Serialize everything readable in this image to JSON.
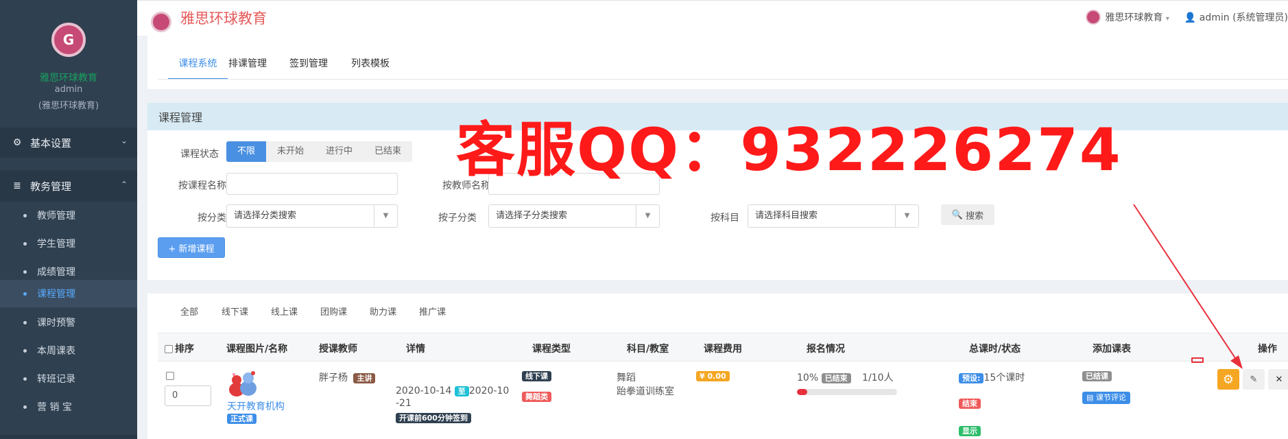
{
  "sidebar": {
    "brand": "雅思环球教育",
    "username": "admin",
    "role": "(雅思环球教育)",
    "sections": [
      {
        "label": "基本设置",
        "icon": "gear-icon",
        "expanded": false
      },
      {
        "label": "教务管理",
        "icon": "database-icon",
        "expanded": true
      }
    ],
    "items": [
      {
        "label": "教师管理",
        "active": false
      },
      {
        "label": "学生管理",
        "active": false
      },
      {
        "label": "成绩管理",
        "active": false
      },
      {
        "label": "课程管理",
        "active": true
      },
      {
        "label": "课时预警",
        "active": false
      },
      {
        "label": "本周课表",
        "active": false
      },
      {
        "label": "转班记录",
        "active": false
      },
      {
        "label": "营 销 宝",
        "active": false
      }
    ]
  },
  "topbar": {
    "title": "雅思环球教育",
    "org": "雅思环球教育",
    "user": "admin (系统管理员)"
  },
  "tabs": [
    "课程系统",
    "排课管理",
    "签到管理",
    "列表模板"
  ],
  "active_tab": "课程系统",
  "search": {
    "title": "课程管理",
    "status_label": "课程状态",
    "status_options": [
      "不限",
      "未开始",
      "进行中",
      "已结束"
    ],
    "status_selected": "不限",
    "course_name_label": "按课程名称",
    "teacher_name_label": "按教师名称",
    "category_label": "按分类",
    "category_placeholder": "请选择分类搜索",
    "subcategory_label": "按子分类",
    "subcategory_placeholder": "请选择子分类搜索",
    "subject_label": "按科目",
    "subject_placeholder": "请选择科目搜索",
    "search_button": "搜索",
    "add_button": "+ 新增课程"
  },
  "watermark": "客服QQ：932226274",
  "filter_tabs": [
    "全部",
    "线下课",
    "线上课",
    "团购课",
    "助力课",
    "推广课"
  ],
  "table": {
    "headers": [
      "排序",
      "课程图片/名称",
      "授课教师",
      "详情",
      "课程类型",
      "科目/教室",
      "课程费用",
      "报名情况",
      "总课时/状态",
      "添加课表",
      "操作"
    ],
    "rows": [
      {
        "sort": "0",
        "course_name": "天开教育机构",
        "course_tag": "正式课",
        "teacher": "胖子杨",
        "teacher_tag": "主讲",
        "date_start": "2020-10-14",
        "date_sep": "至",
        "date_end_a": "2020-10",
        "date_end_b": "-21",
        "checkin_tag": "开课前600分钟签到",
        "type_tag": "线下课",
        "category_tag": "舞蹈类",
        "subject": "舞蹈",
        "classroom": "跆拳道训练室",
        "fee": "¥ 0.00",
        "enroll_percent": "10%",
        "enroll_state": "已结束",
        "enroll_count": "1/10人",
        "enroll_progress": 0.1,
        "preset_tag": "预设:",
        "total_hours": "15个课时",
        "end_tag": "结束",
        "show_tag": "显示",
        "schedule_tag": "已结课",
        "review_button": "课节评论"
      }
    ]
  },
  "colors": {
    "accent": "#4a90e2",
    "brand_text": "#e65a5a",
    "sidebar_bg": "#2f4050",
    "watermark": "#ff1a1a"
  }
}
